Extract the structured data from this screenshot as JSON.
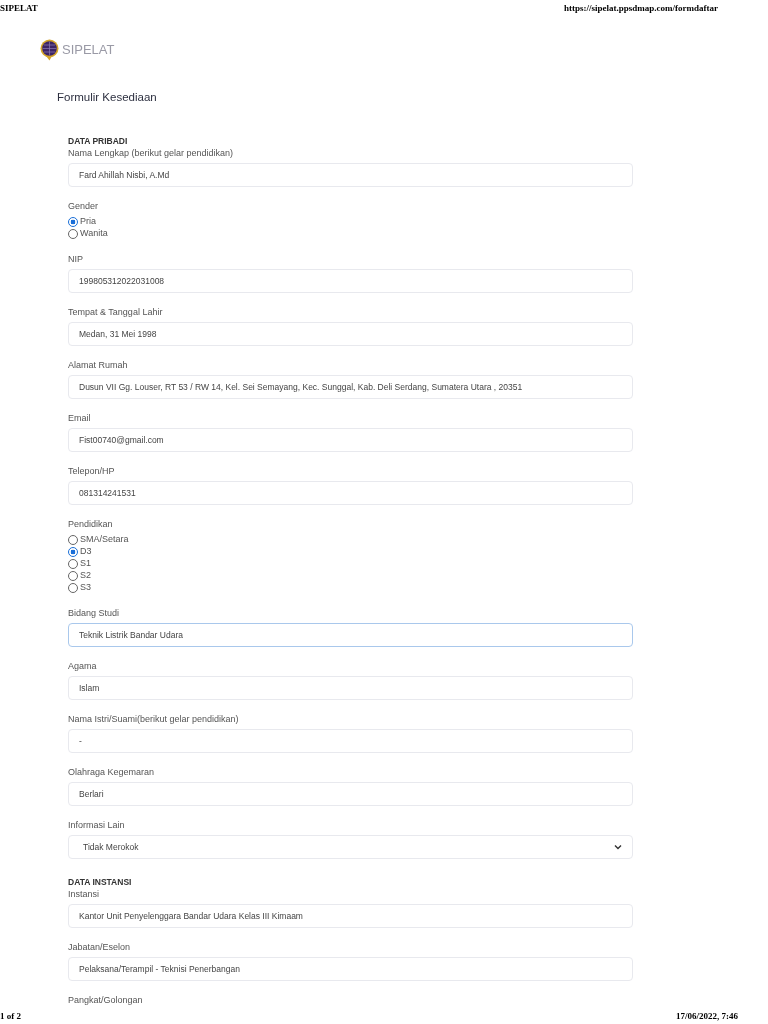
{
  "print_header": {
    "title": "SIPELAT",
    "url": "https://sipelat.ppsdmap.com/formdaftar"
  },
  "logo": {
    "text": "SIPELAT"
  },
  "form_title": "Formulir Kesediaan",
  "sections": [
    {
      "heading": "DATA PRIBADI",
      "fields": [
        {
          "kind": "text",
          "label": "Nama Lengkap (berikut gelar pendidikan)",
          "value": "Fard Ahillah Nisbi, A.Md",
          "focused": false
        },
        {
          "kind": "radio",
          "label": "Gender",
          "options": [
            {
              "label": "Pria",
              "selected": true
            },
            {
              "label": "Wanita",
              "selected": false
            }
          ]
        },
        {
          "kind": "text",
          "label": "NIP",
          "value": "199805312022031008",
          "focused": false
        },
        {
          "kind": "text",
          "label": "Tempat & Tanggal Lahir",
          "value": "Medan, 31 Mei 1998",
          "focused": false
        },
        {
          "kind": "text",
          "label": "Alamat Rumah",
          "value": "Dusun VII Gg. Louser, RT 53 / RW 14, Kel. Sei Semayang, Kec. Sunggal, Kab. Deli Serdang, Sumatera Utara , 20351",
          "focused": false
        },
        {
          "kind": "text",
          "label": "Email",
          "value": "Fist00740@gmail.com",
          "focused": false
        },
        {
          "kind": "text",
          "label": "Telepon/HP",
          "value": "081314241531",
          "focused": false
        },
        {
          "kind": "radio",
          "label": "Pendidikan",
          "options": [
            {
              "label": "SMA/Setara",
              "selected": false
            },
            {
              "label": "D3",
              "selected": true
            },
            {
              "label": "S1",
              "selected": false
            },
            {
              "label": "S2",
              "selected": false
            },
            {
              "label": "S3",
              "selected": false
            }
          ]
        },
        {
          "kind": "text",
          "label": "Bidang Studi",
          "value": "Teknik Listrik Bandar Udara",
          "focused": true
        },
        {
          "kind": "text",
          "label": "Agama",
          "value": "Islam",
          "focused": false
        },
        {
          "kind": "text",
          "label": "Nama Istri/Suami(berikut gelar pendidikan)",
          "value": "-",
          "focused": false
        },
        {
          "kind": "text",
          "label": "Olahraga Kegemaran",
          "value": "Berlari",
          "focused": false
        },
        {
          "kind": "select",
          "label": "Informasi Lain",
          "value": "Tidak Merokok"
        }
      ]
    },
    {
      "heading": "DATA INSTANSI",
      "fields": [
        {
          "kind": "text",
          "label": "Instansi",
          "value": "Kantor Unit Penyelenggara Bandar Udara Kelas III Kimaam",
          "focused": false
        },
        {
          "kind": "text",
          "label": "Jabatan/Eselon",
          "value": "Pelaksana/Terampil - Teknisi Penerbangan",
          "focused": false
        },
        {
          "kind": "label",
          "label": "Pangkat/Golongan"
        }
      ]
    }
  ],
  "print_footer": {
    "page": "1 of 2",
    "datetime": "17/06/2022, 7:46"
  }
}
